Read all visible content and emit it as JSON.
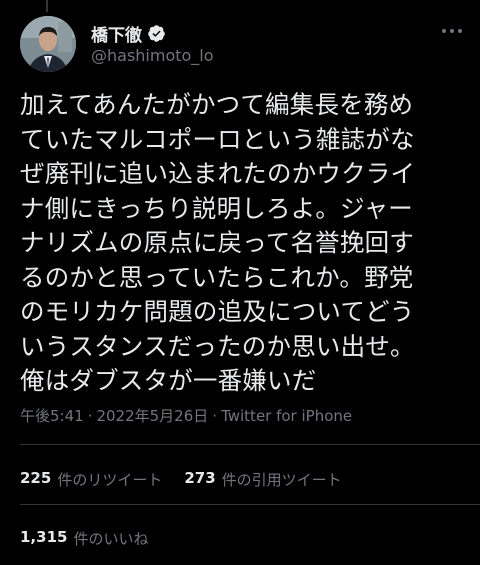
{
  "user": {
    "display_name": "橋下徹",
    "handle": "@hashimoto_lo",
    "verified_color": "#e7e9ea"
  },
  "tweet": {
    "lines": [
      "加えてあんたがかつて編集長を務め",
      "ていたマルコポーロという雑誌がな",
      "ぜ廃刊に追い込まれたのかウクライ",
      "ナ側にきっちり説明しろよ。ジャー",
      "ナリズムの原点に戻って名誉挽回す",
      "るのかと思っていたらこれか。野党",
      "のモリカケ問題の追及についてどう",
      "いうスタンスだったのか思い出せ。",
      "俺はダブスタが一番嫌いだ"
    ]
  },
  "meta": {
    "time": "午後5:41",
    "date": "2022年5月26日",
    "source": "Twitter for iPhone",
    "separator": "·"
  },
  "stats": {
    "retweets_count": "225",
    "retweets_label": "件のリツイート",
    "quotes_count": "273",
    "quotes_label": "件の引用ツイート",
    "likes_count": "1,315",
    "likes_label": "件のいいね"
  },
  "colors": {
    "background": "#000000",
    "text": "#e7e9ea",
    "secondary": "#71767b",
    "divider": "#2f3336"
  }
}
